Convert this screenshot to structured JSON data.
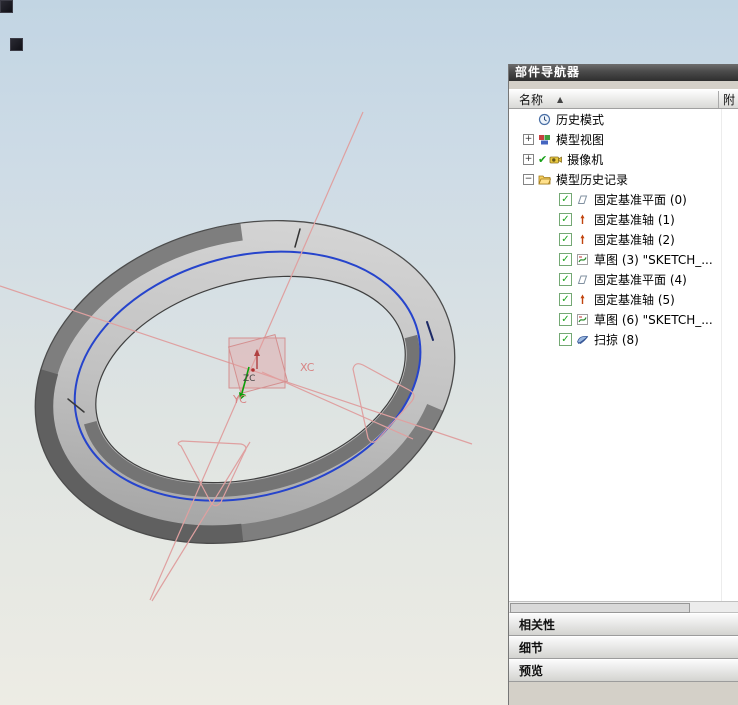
{
  "viewport": {
    "labels": {
      "xc": "XC",
      "yc": "YC",
      "zc": "ZC"
    },
    "colors": {
      "bg_top": "#c2d5e3",
      "bg_bottom": "#edece4",
      "ring_light": "#d4d4d4",
      "ring_dark": "#606060",
      "highlight_edge_blue": "#2644cc",
      "sketch_pink": "#dfa0a0",
      "axis_green": "#0aa00a",
      "axis_label_red": "#d88484"
    }
  },
  "panel": {
    "title": "部件导航器",
    "columns": [
      {
        "label": "名称",
        "sort": "asc"
      },
      {
        "label": "附"
      }
    ],
    "tree": [
      {
        "label": "历史模式",
        "icon": "clock",
        "expander": null,
        "check": false,
        "checkbox": false,
        "level": 0
      },
      {
        "label": "模型视图",
        "icon": "model-views",
        "expander": "plus",
        "check": false,
        "checkbox": false,
        "level": 0
      },
      {
        "label": "摄像机",
        "icon": "camera",
        "expander": "plus",
        "check": true,
        "checkbox": false,
        "level": 0
      },
      {
        "label": "模型历史记录",
        "icon": "folder-open",
        "expander": "minus",
        "check": false,
        "checkbox": false,
        "level": 0
      },
      {
        "label": "固定基准平面 (0)",
        "icon": "datum-plane",
        "expander": null,
        "check": false,
        "checkbox": true,
        "level": 2
      },
      {
        "label": "固定基准轴 (1)",
        "icon": "datum-axis",
        "expander": null,
        "check": false,
        "checkbox": true,
        "level": 2
      },
      {
        "label": "固定基准轴 (2)",
        "icon": "datum-axis",
        "expander": null,
        "check": false,
        "checkbox": true,
        "level": 2
      },
      {
        "label": "草图 (3) \"SKETCH_...",
        "icon": "sketch",
        "expander": null,
        "check": false,
        "checkbox": true,
        "level": 2
      },
      {
        "label": "固定基准平面 (4)",
        "icon": "datum-plane",
        "expander": null,
        "check": false,
        "checkbox": true,
        "level": 2
      },
      {
        "label": "固定基准轴 (5)",
        "icon": "datum-axis",
        "expander": null,
        "check": false,
        "checkbox": true,
        "level": 2
      },
      {
        "label": "草图 (6) \"SKETCH_...",
        "icon": "sketch",
        "expander": null,
        "check": false,
        "checkbox": true,
        "level": 2
      },
      {
        "label": "扫掠 (8)",
        "icon": "sweep",
        "expander": null,
        "check": false,
        "checkbox": true,
        "level": 2
      }
    ],
    "sections": [
      "相关性",
      "细节",
      "预览"
    ],
    "sort_indicator": "▲"
  }
}
